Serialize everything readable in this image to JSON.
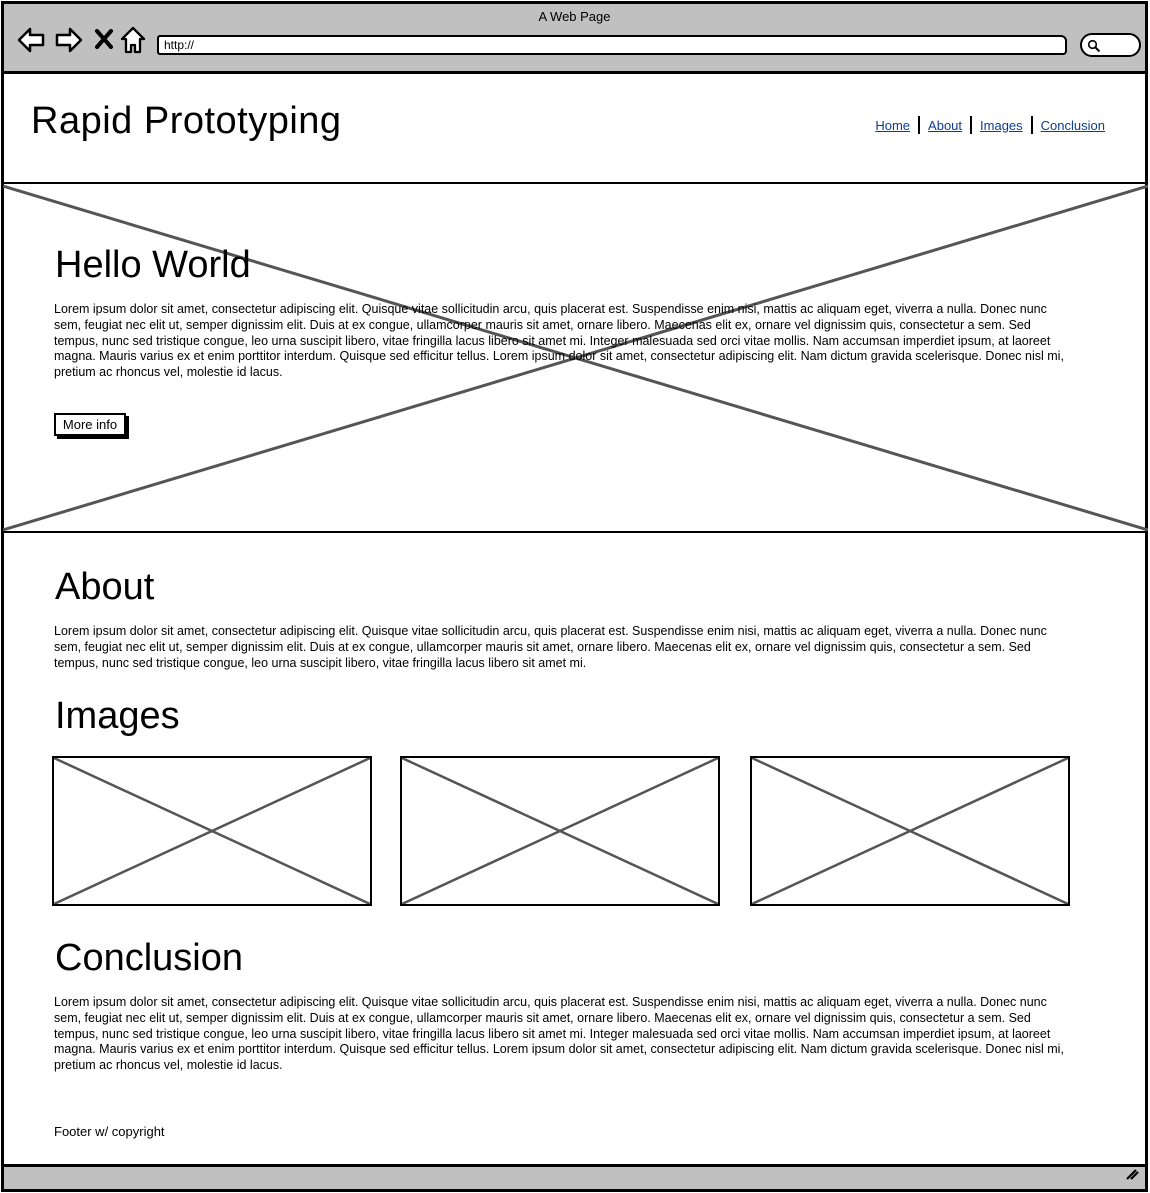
{
  "browser": {
    "window_title": "A Web Page",
    "url": "http://",
    "icons": [
      "back-icon",
      "forward-icon",
      "close-icon",
      "home-icon",
      "search-icon",
      "resize-grip-icon"
    ]
  },
  "header": {
    "site_title": "Rapid Prototyping",
    "nav": [
      {
        "label": "Home"
      },
      {
        "label": "About"
      },
      {
        "label": "Images"
      },
      {
        "label": "Conclusion"
      }
    ]
  },
  "hero": {
    "heading": "Hello World",
    "text": "Lorem ipsum dolor sit amet, consectetur adipiscing elit. Quisque vitae sollicitudin arcu, quis placerat est. Suspendisse enim nisi, mattis ac aliquam eget, viverra a nulla. Donec nunc sem, feugiat nec elit ut, semper dignissim elit. Duis at ex congue, ullamcorper mauris sit amet, ornare libero. Maecenas elit ex, ornare vel dignissim quis, consectetur a sem. Sed tempus, nunc sed tristique congue, leo urna suscipit libero, vitae fringilla lacus libero sit amet mi. Integer malesuada sed orci vitae mollis. Nam accumsan imperdiet ipsum, at laoreet magna. Mauris varius ex et enim porttitor interdum. Quisque sed efficitur tellus. Lorem ipsum dolor sit amet, consectetur adipiscing elit. Nam dictum gravida scelerisque. Donec nisl mi, pretium ac rhoncus vel, molestie id lacus.",
    "button_label": "More info"
  },
  "about": {
    "heading": "About",
    "text": "Lorem ipsum dolor sit amet, consectetur adipiscing elit. Quisque vitae sollicitudin arcu, quis placerat est. Suspendisse enim nisi, mattis ac aliquam eget, viverra a nulla. Donec nunc sem, feugiat nec elit ut, semper dignissim elit. Duis at ex congue, ullamcorper mauris sit amet, ornare libero. Maecenas elit ex, ornare vel dignissim quis, consectetur a sem. Sed tempus, nunc sed tristique congue, leo urna suscipit libero, vitae fringilla lacus libero sit amet mi."
  },
  "images": {
    "heading": "Images"
  },
  "conclusion": {
    "heading": "Conclusion",
    "text": "Lorem ipsum dolor sit amet, consectetur adipiscing elit. Quisque vitae sollicitudin arcu, quis placerat est. Suspendisse enim nisi, mattis ac aliquam eget, viverra a nulla. Donec nunc sem, feugiat nec elit ut, semper dignissim elit. Duis at ex congue, ullamcorper mauris sit amet, ornare libero. Maecenas elit ex, ornare vel dignissim quis, consectetur a sem. Sed tempus, nunc sed tristique congue, leo urna suscipit libero, vitae fringilla lacus libero sit amet mi. Integer malesuada sed orci vitae mollis. Nam accumsan imperdiet ipsum, at laoreet magna. Mauris varius ex et enim porttitor interdum. Quisque sed efficitur tellus. Lorem ipsum dolor sit amet, consectetur adipiscing elit. Nam dictum gravida scelerisque. Donec nisl mi, pretium ac rhoncus vel, molestie id lacus."
  },
  "footer": {
    "text": "Footer w/ copyright"
  },
  "colors": {
    "chrome": "#c0c0c0",
    "link": "#0b3d91",
    "placeholder_stroke": "#555555"
  }
}
